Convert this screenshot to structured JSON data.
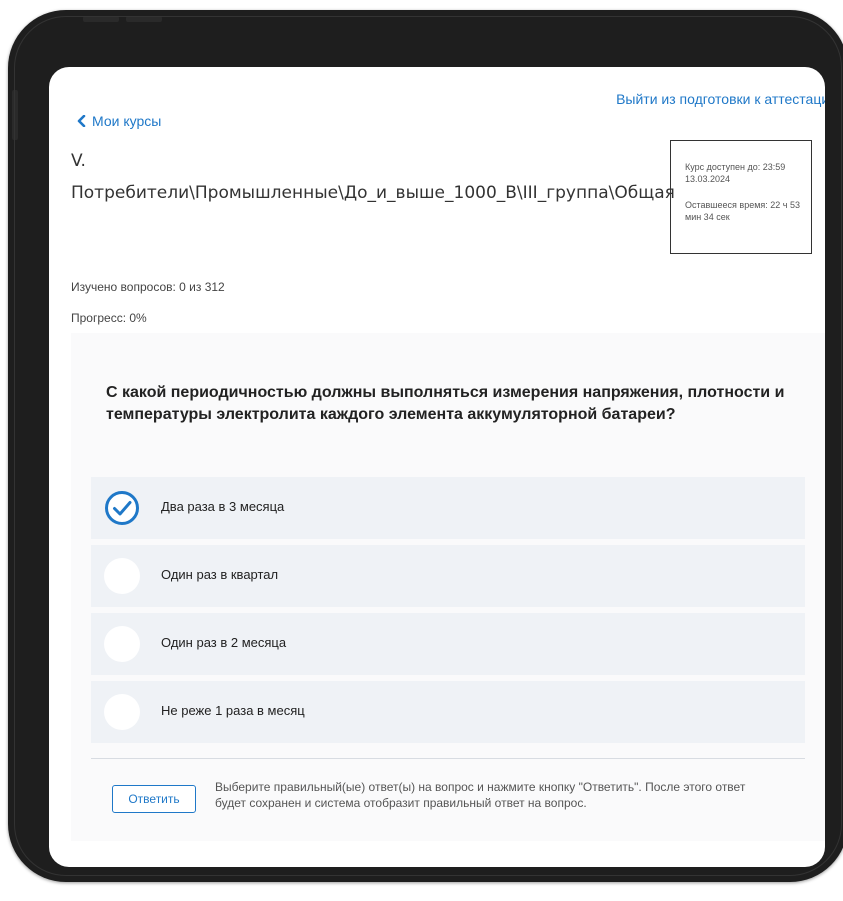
{
  "header": {
    "exit_link": "Выйти из подготовки к аттестации",
    "back_link": "Мои курсы"
  },
  "course": {
    "title_line1": "V.",
    "title_line2": "Потребители\\Промышленные\\До_и_выше_1000_В\\III_группа\\Общая"
  },
  "timer": {
    "available_until": "Курс доступен до: 23:59 13.03.2024",
    "remaining": "Оставшееся время: 22 ч 53 мин 34 сек"
  },
  "stats": {
    "studied": "Изучено вопросов: 0 из 312",
    "progress": "Прогресс: 0%"
  },
  "quiz": {
    "question": "С какой периодичностью должны выполняться измерения напряжения, плотности и температуры электролита каждого элемента аккумуляторной батареи?",
    "options": [
      {
        "label": "Два раза в 3 месяца",
        "selected": true
      },
      {
        "label": "Один раз в квартал",
        "selected": false
      },
      {
        "label": "Один раз в 2 месяца",
        "selected": false
      },
      {
        "label": "Не реже 1 раза в месяц",
        "selected": false
      }
    ],
    "answer_button": "Ответить",
    "hint": "Выберите правильный(ые) ответ(ы) на вопрос и нажмите кнопку \"Ответить\". После этого ответ будет сохранен и система отобразит правильный ответ на вопрос."
  },
  "colors": {
    "accent": "#1f78c8",
    "option_bg": "#eff2f6",
    "device_frame": "#1e1e1e"
  },
  "icons": {
    "back": "chevron-left-icon",
    "selected": "check-circle-icon"
  }
}
